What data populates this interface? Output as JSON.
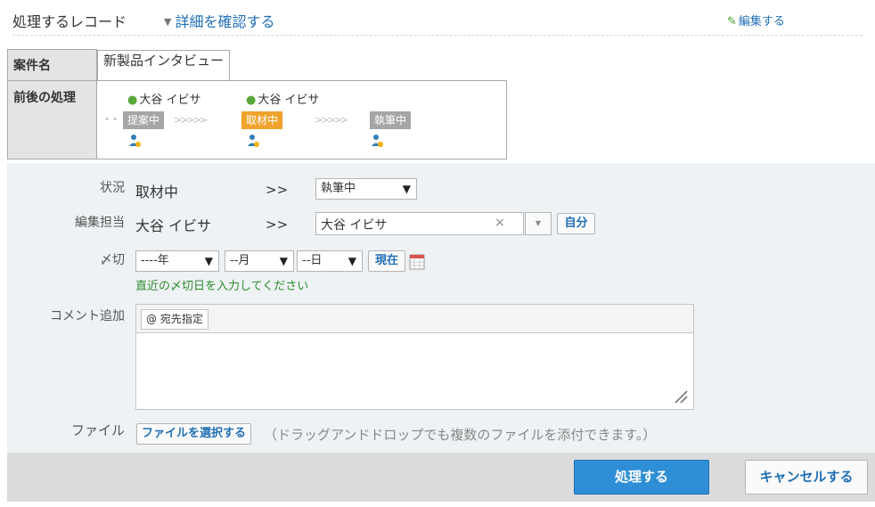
{
  "header": {
    "title": "処理するレコード",
    "detail_link": "詳細を確認する",
    "edit_link": "編集する"
  },
  "record": {
    "case_label": "案件名",
    "case_value": "新製品インタビュー",
    "process_label": "前後の処理",
    "assignees": [
      "大谷 イビサ",
      "大谷 イビサ"
    ],
    "steps": [
      "提案中",
      "取材中",
      "執筆中"
    ],
    "active_step_index": 1,
    "arrows": ">>>>>"
  },
  "form": {
    "status_label": "状況",
    "status_current": "取材中",
    "status_arrow": ">>",
    "status_next": "執筆中",
    "editor_label": "編集担当",
    "editor_current": "大谷 イビサ",
    "editor_arrow": ">>",
    "editor_next": "大谷 イビサ",
    "clear_symbol": "×",
    "self_button": "自分",
    "deadline_label": "〆切",
    "year_placeholder": "----年",
    "month_placeholder": "--月",
    "day_placeholder": "--日",
    "now_button": "現在",
    "deadline_hint": "直近の〆切日を入力してください",
    "comment_label": "コメント追加",
    "mention_button": "@ 宛先指定",
    "file_label": "ファイル",
    "file_button": "ファイルを選択する",
    "file_note": "（ドラッグアンドドロップでも複数のファイルを添付できます。）"
  },
  "footer": {
    "submit": "処理する",
    "cancel": "キャンセルする"
  },
  "colors": {
    "link": "#1f6fb5",
    "active_step": "#f0a32c",
    "inactive_step": "#a6a6a6",
    "primary_button": "#2e8fd6",
    "hint_text": "#2e8b2e"
  }
}
